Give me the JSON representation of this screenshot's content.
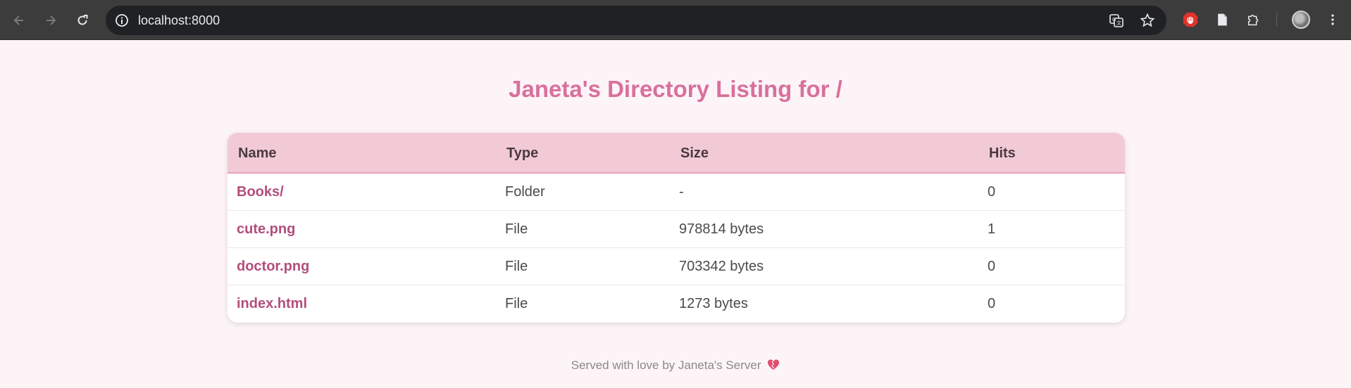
{
  "browser": {
    "url": "localhost:8000"
  },
  "page": {
    "title": "Janeta's Directory Listing for /",
    "columns": {
      "name": "Name",
      "type": "Type",
      "size": "Size",
      "hits": "Hits"
    },
    "rows": [
      {
        "name": "Books/",
        "type": "Folder",
        "size": "-",
        "hits": "0"
      },
      {
        "name": "cute.png",
        "type": "File",
        "size": "978814 bytes",
        "hits": "1"
      },
      {
        "name": "doctor.png",
        "type": "File",
        "size": "703342 bytes",
        "hits": "0"
      },
      {
        "name": "index.html",
        "type": "File",
        "size": "1273 bytes",
        "hits": "0"
      }
    ],
    "footer": "Served with love by Janeta's Server",
    "footer_icon": "heart-icon"
  },
  "colors": {
    "title": "#d9709c",
    "header_bg": "#f1cad6",
    "link": "#b24e7c",
    "page_bg": "#fdf4f8"
  }
}
